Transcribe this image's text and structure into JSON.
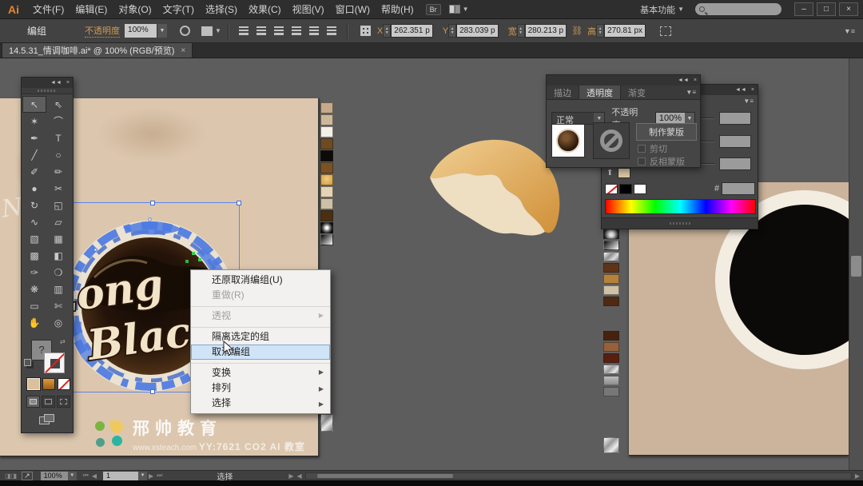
{
  "window": {
    "minimize": "–",
    "maximize": "□",
    "close": "×"
  },
  "menu_bar": {
    "logo": "Ai",
    "items": [
      "文件(F)",
      "编辑(E)",
      "对象(O)",
      "文字(T)",
      "选择(S)",
      "效果(C)",
      "视图(V)",
      "窗口(W)",
      "帮助(H)"
    ],
    "br": "Br",
    "workspace": "基本功能",
    "caret": "▼"
  },
  "control_bar": {
    "group_label": "编组",
    "opacity_label": "不透明度",
    "opacity_value": "100%",
    "x_label": "X",
    "x_value": "262.351 p",
    "y_label": "Y",
    "y_value": "283.039 p",
    "w_label": "宽",
    "w_value": "280.213 p",
    "h_label": "高",
    "h_value": "270.81 px",
    "chain": "⛓"
  },
  "document_tab": {
    "title": "14.5.31_情调咖啡.ai* @ 100% (RGB/预览)",
    "close": "×"
  },
  "toolbox": {
    "collapse": "◄◄",
    "close": "×",
    "fill_placeholder": "?",
    "tools": [
      {
        "n": "selection-tool",
        "g": "↖",
        "c": "active"
      },
      {
        "n": "direct-selection-tool",
        "g": "⇖",
        "c": ""
      },
      {
        "n": "magic-wand-tool",
        "g": "✶",
        "c": ""
      },
      {
        "n": "lasso-tool",
        "g": "⌒",
        "c": ""
      },
      {
        "n": "pen-tool",
        "g": "✒",
        "c": ""
      },
      {
        "n": "type-tool",
        "g": "T",
        "c": ""
      },
      {
        "n": "line-tool",
        "g": "╱",
        "c": ""
      },
      {
        "n": "ellipse-tool",
        "g": "○",
        "c": ""
      },
      {
        "n": "paintbrush-tool",
        "g": "✐",
        "c": ""
      },
      {
        "n": "pencil-tool",
        "g": "✏",
        "c": ""
      },
      {
        "n": "blob-brush-tool",
        "g": "●",
        "c": ""
      },
      {
        "n": "scissors-tool",
        "g": "✂",
        "c": ""
      },
      {
        "n": "rotate-tool",
        "g": "↻",
        "c": ""
      },
      {
        "n": "scale-tool",
        "g": "◱",
        "c": ""
      },
      {
        "n": "width-tool",
        "g": "∿",
        "c": ""
      },
      {
        "n": "free-transform-tool",
        "g": "▱",
        "c": ""
      },
      {
        "n": "shape-builder-tool",
        "g": "▧",
        "c": ""
      },
      {
        "n": "perspective-grid-tool",
        "g": "▦",
        "c": ""
      },
      {
        "n": "mesh-tool",
        "g": "▩",
        "c": ""
      },
      {
        "n": "gradient-tool",
        "g": "◧",
        "c": ""
      },
      {
        "n": "eyedropper-tool",
        "g": "✑",
        "c": ""
      },
      {
        "n": "blend-tool",
        "g": "❍",
        "c": ""
      },
      {
        "n": "symbol-sprayer-tool",
        "g": "❋",
        "c": ""
      },
      {
        "n": "column-graph-tool",
        "g": "▥",
        "c": ""
      },
      {
        "n": "artboard-tool",
        "g": "▭",
        "c": ""
      },
      {
        "n": "slice-tool",
        "g": "✄",
        "c": ""
      },
      {
        "n": "hand-tool",
        "g": "✋",
        "c": ""
      },
      {
        "n": "zoom-tool",
        "g": "◎",
        "c": ""
      }
    ]
  },
  "context_menu": {
    "items": [
      {
        "label": "还原取消编组(U)",
        "a": "",
        "c": ""
      },
      {
        "label": "重做(R)",
        "a": "",
        "c": "disabled"
      },
      {
        "label": "透视",
        "a": "▶",
        "c": "disabled septop"
      },
      {
        "label": "隔离选定的组",
        "a": "",
        "c": "septop"
      },
      {
        "label": "取消编组",
        "a": "",
        "c": "highlighted"
      },
      {
        "label": "变换",
        "a": "▶",
        "c": "septop"
      },
      {
        "label": "排列",
        "a": "▶",
        "c": ""
      },
      {
        "label": "选择",
        "a": "▶",
        "c": ""
      }
    ]
  },
  "transparency_panel": {
    "collapse": "◄◄",
    "close": "×",
    "menu": "▼≡",
    "tabs": [
      {
        "label": "描边",
        "c": ""
      },
      {
        "label": "透明度",
        "c": "active"
      },
      {
        "label": "渐变",
        "c": ""
      }
    ],
    "blend_mode": "正常",
    "opacity_label": "不透明度:",
    "opacity_value": "100%",
    "make_mask_label": "制作蒙版",
    "clip_label": "剪切",
    "invert_label": "反相蒙版"
  },
  "color_panel": {
    "collapse": "◄◄",
    "close": "×",
    "menu": "▼≡",
    "hex_label": "#",
    "fill_swatch": "#d8c5a0"
  },
  "status_bar": {
    "zoom_value": "100%",
    "artboard_value": "1",
    "status_text": "选择"
  },
  "canvas": {
    "logo_line1": "Long",
    "logo_line2": "Black",
    "watermark_title": "邢帅教育",
    "watermark_url": "www.xsteach.com",
    "watermark_info": "YY:7621 CO2 AI 教室",
    "ghost_letter": "N"
  },
  "swatches": {
    "strip1": [
      "#c6a988",
      "#cdb79b",
      "#f4efe7",
      "#6e4b22",
      "#0d0a07",
      "#7b5226",
      "radial-gradient(circle at 50% 40%, #f0cd82, #d29a3e)",
      "#e4d3b4",
      "#cec0a6",
      "#4b2f12",
      "radial-gradient(circle, #ffffff 15%, #777777 45%, #0a0a0a 80%)",
      "linear-gradient(135deg, #0a0a0a, #f5f5f5)"
    ],
    "strip1_tail": [
      "linear-gradient(135deg, #fdfdfd 0%, #9a9a9a 35%, #e8e8e8 60%, #6f6f6f 100%)"
    ],
    "strip2a": [
      "radial-gradient(circle, #f5f5f5 20%, #8a8a8a 55%, #222222 85%)",
      "linear-gradient(135deg, #0a0a0a, #fafafa)",
      "linear-gradient(135deg, #f8f8f8, #8f8f8f 40%, #dcdcdc 70%, #777777)",
      "#5e3317",
      "#b5823b",
      "#cfc0a6",
      "#4f2a10"
    ],
    "strip2b": [
      "#46220e",
      "#95603c",
      "#581f10",
      "linear-gradient(135deg, #f2f2f2, #9c9c9c 45%, #e6e6e6 75%, #808080)",
      "linear-gradient(180deg, #bdbdbd, #8d8d8d)",
      "rgba(200,200,200,0.25)"
    ],
    "strip2c": [
      "linear-gradient(135deg, #fafafa, #9a9a9a 40%, #ededed 70%, #787878)"
    ]
  },
  "colors": {
    "selection_blue": "#4d7be2",
    "artboard_left": "#dcc7ae",
    "artboard_right": "#cbb49b",
    "pasteboard": "#5d5d5d",
    "accent_orange": "#cf9a52",
    "coffee_dark": "#1c1008",
    "cream_text": "#f1e4c8",
    "croissant_gold": "#e2ae62"
  }
}
